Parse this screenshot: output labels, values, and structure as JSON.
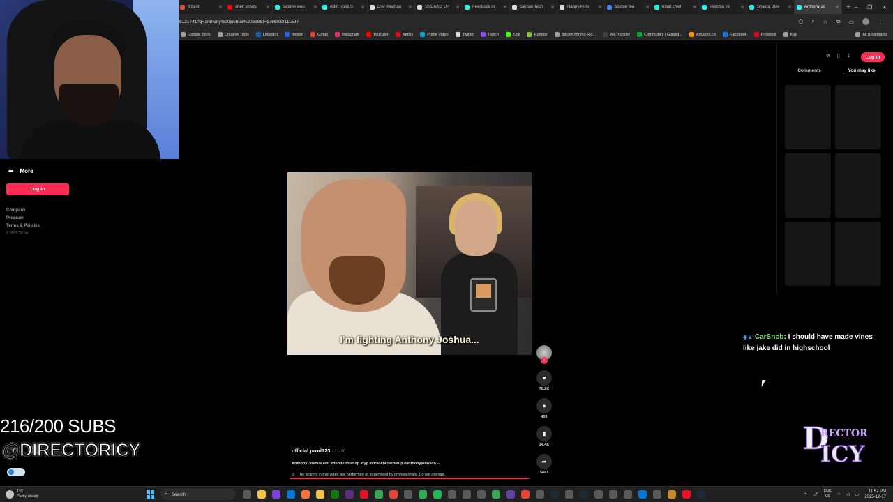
{
  "browser": {
    "tabs": [
      {
        "label": "0 best",
        "color": "#e64a3c"
      },
      {
        "label": "shelf shorts",
        "color": "#ff0000"
      },
      {
        "label": "6ix9ine wou",
        "color": "#25f4ee"
      },
      {
        "label": "Adin Ross S",
        "color": "#25f4ee"
      },
      {
        "label": "Dov Kleiman",
        "color": "#dddddd"
      },
      {
        "label": "SNEAKO UP",
        "color": "#dddddd"
      },
      {
        "label": "FearBuck or",
        "color": "#25f4ee"
      },
      {
        "label": "Genius Tech",
        "color": "#dddddd"
      },
      {
        "label": "Happy Puni",
        "color": "#dddddd"
      },
      {
        "label": "boston tea",
        "color": "#4285f4"
      },
      {
        "label": "tribal chief",
        "color": "#25f4ee"
      },
      {
        "label": "Teofimo vs",
        "color": "#25f4ee"
      },
      {
        "label": "Shakur Stev",
        "color": "#25f4ee"
      },
      {
        "label": "Anthony Jo",
        "color": "#25f4ee",
        "active": true
      }
    ],
    "new_tab": "+",
    "window_controls": [
      "–",
      "❐",
      "✕"
    ],
    "url": "8121741?q=anthony%20joshua%20edit&t=1766032111597",
    "bookmarks": [
      {
        "label": "Google Tools",
        "color": "#9e9e9e"
      },
      {
        "label": "Creative Tools",
        "color": "#9e9e9e"
      },
      {
        "label": "LinkedIn",
        "color": "#0a66c2"
      },
      {
        "label": "Indeed",
        "color": "#2164f3"
      },
      {
        "label": "Gmail",
        "color": "#ea4335"
      },
      {
        "label": "Instagram",
        "color": "#e1306c"
      },
      {
        "label": "YouTube",
        "color": "#ff0000"
      },
      {
        "label": "Netflix",
        "color": "#e50914"
      },
      {
        "label": "Prime Video",
        "color": "#00a8e1"
      },
      {
        "label": "Twitter",
        "color": "#dddddd"
      },
      {
        "label": "Twitch",
        "color": "#9146ff"
      },
      {
        "label": "Kick",
        "color": "#53fc18"
      },
      {
        "label": "Rumble",
        "color": "#85c742"
      },
      {
        "label": "Bitcoin Mining Rig...",
        "color": "#9e9e9e"
      },
      {
        "label": "WeTransfer",
        "color": "#444444"
      },
      {
        "label": "Community | Glassd...",
        "color": "#0caa41"
      },
      {
        "label": "Amazon.ca",
        "color": "#ff9900"
      },
      {
        "label": "Facebook",
        "color": "#1877f2"
      },
      {
        "label": "Pinterest",
        "color": "#e60023"
      },
      {
        "label": "Kijiji",
        "color": "#9e9e9e"
      }
    ],
    "all_bookmarks": "All Bookmarks"
  },
  "sidebar": {
    "more": "More",
    "login": "Log in",
    "links": [
      "Company",
      "Program",
      "Terms & Policies"
    ],
    "copyright": "© 2025 TikTok"
  },
  "video": {
    "subtitle": "I'm fighting Anthony Joshua...",
    "progress": 0.99
  },
  "actions": {
    "likes": "78.2K",
    "comments": "403",
    "saves": "14.4K",
    "shares": "5441"
  },
  "caption": {
    "author": "official.prod123",
    "date": " · 11-20",
    "description": "Anthony Joshua edit #dontletthisflop #fyp #viral #blowthisup #anthonyjohnson --",
    "warning": "The actions in this video are performed or supervised by professionals. Do not attempt."
  },
  "right_panel": {
    "login": "Log in",
    "tabs": [
      "Comments",
      "You may like"
    ],
    "active_tab": "You may like"
  },
  "overlay": {
    "chat_user": "CarSnob",
    "chat_message": ": I should have made vines like jake did in highschool",
    "subs": "216/200 SUBS",
    "handle": "@DIRECTORICY",
    "logo_d": "D",
    "logo_top": "RECTOR",
    "logo_bottom": "ICY"
  },
  "taskbar": {
    "temp": "1°C",
    "weather": "Partly cloudy",
    "search": "Search",
    "lang1": "ENG",
    "lang2": "US",
    "time": "11:57 PM",
    "date": "2025-12-17",
    "apps": [
      "#5a5a5a",
      "#f5c542",
      "#7b3fe4",
      "#0078d4",
      "#ff7139",
      "#f5c542",
      "#0f7b0f",
      "#5b2c83",
      "#e81123",
      "#34a853",
      "#ea4335",
      "#5a5a5a",
      "#34a853",
      "#1db954",
      "#5a5a5a",
      "#5a5a5a",
      "#5a5a5a",
      "#34a853",
      "#6441a5",
      "#ea4335",
      "#5a5a5a",
      "#1b2838",
      "#5a5a5a",
      "#1b2838",
      "#5a5a5a",
      "#5a5a5a",
      "#5a5a5a",
      "#0078d4",
      "#5a5a5a",
      "#c98a2c",
      "#e81123",
      "#1b2838"
    ]
  }
}
